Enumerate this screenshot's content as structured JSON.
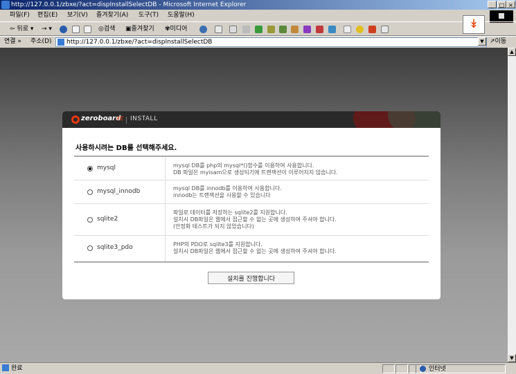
{
  "window": {
    "title": "http://127.0.0.1/zbxe/?act=dispInstallSelectDB - Microsoft Internet Explorer",
    "controls": [
      "_",
      "□",
      "×"
    ]
  },
  "menu": [
    "파일(F)",
    "편집(E)",
    "보기(V)",
    "즐겨찾기(A)",
    "도구(T)",
    "도움말(H)"
  ],
  "toolbar": {
    "back": "뒤로",
    "search": "검색",
    "favorites": "즐겨찾기",
    "media": "미디어",
    "throbber_glyph": "↡"
  },
  "addressbar": {
    "links_label": "연결 »",
    "address_label": "주소(D)",
    "url": "http://127.0.0.1/zbxe/?act=dispInstallSelectDB",
    "go_label": "이동"
  },
  "install": {
    "logo_text": "zeroboard",
    "logo_sup": "XE",
    "header_label": "INSTALL",
    "prompt": "사용하시려는 DB를 선택해주세요.",
    "options": [
      {
        "name": "mysql",
        "selected": true,
        "desc": [
          "mysql DB를 php의 mysql*()함수를 이용하여 사용합니다.",
          "DB 파일은 myisam으로 생성되기에 트랜잭션이 이루어지지 않습니다."
        ]
      },
      {
        "name": "mysql_innodb",
        "selected": false,
        "desc": [
          "mysql DB를 innodb를 이용하여 사용합니다.",
          "innodb는 트랜잭션을 사용할 수 있습니다"
        ]
      },
      {
        "name": "sqlite2",
        "selected": false,
        "desc": [
          "파일로 데이터를 저장하는 sqlite2를 지원합니다.",
          "설치시 DB파일은 웹에서 접근할 수 없는 곳에 생성하여 주셔야 합니다.",
          "(안정화 테스트가 되지 않았습니다)"
        ]
      },
      {
        "name": "sqlite3_pdo",
        "selected": false,
        "desc": [
          "PHP의 PDO로 sqlite3를 지원합니다.",
          "설치시 DB파일은 웹에서 접근할 수 없는 곳에 생성하여 주셔야 합니다."
        ]
      }
    ],
    "submit_label": "설치를 진행합니다"
  },
  "status": {
    "text": "완료",
    "zone": "인터넷"
  }
}
